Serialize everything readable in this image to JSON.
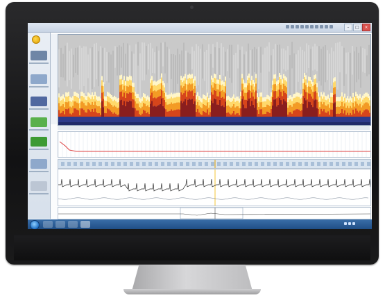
{
  "window": {
    "title": "",
    "controls": {
      "minimize": "–",
      "maximize": "□",
      "close": "×"
    }
  },
  "sidebar": {
    "items": [
      {
        "name": "trend-report",
        "color": "#6f86a6"
      },
      {
        "name": "overview",
        "color": "#8ea8cb"
      },
      {
        "name": "bar-chart",
        "color": "#5068a0"
      },
      {
        "name": "add-marker",
        "color": "#59b04c"
      },
      {
        "name": "add-event",
        "color": "#3d9a33"
      },
      {
        "name": "window",
        "color": "#8ea8cb"
      },
      {
        "name": "settings",
        "color": "#bcc6d4"
      }
    ]
  },
  "spectrogram": {
    "palette": [
      "#2d3b8c",
      "#8a1e1e",
      "#d6451b",
      "#f39b24",
      "#ffd96a",
      "#fff6c9"
    ],
    "background": "#c9c9c9"
  },
  "time_axis": {
    "ticks": [
      "",
      "",
      "",
      "",
      "",
      "",
      "",
      "",
      "",
      "",
      "",
      "",
      "",
      "",
      "",
      "",
      "",
      ""
    ]
  },
  "panels": {
    "trend": {
      "color": "#dd4040"
    },
    "ecg": {
      "color": "#2a2a2a"
    },
    "bottom": {
      "color": "#444444"
    }
  },
  "taskbar": {
    "time": "",
    "accent": "#1f4e86"
  }
}
